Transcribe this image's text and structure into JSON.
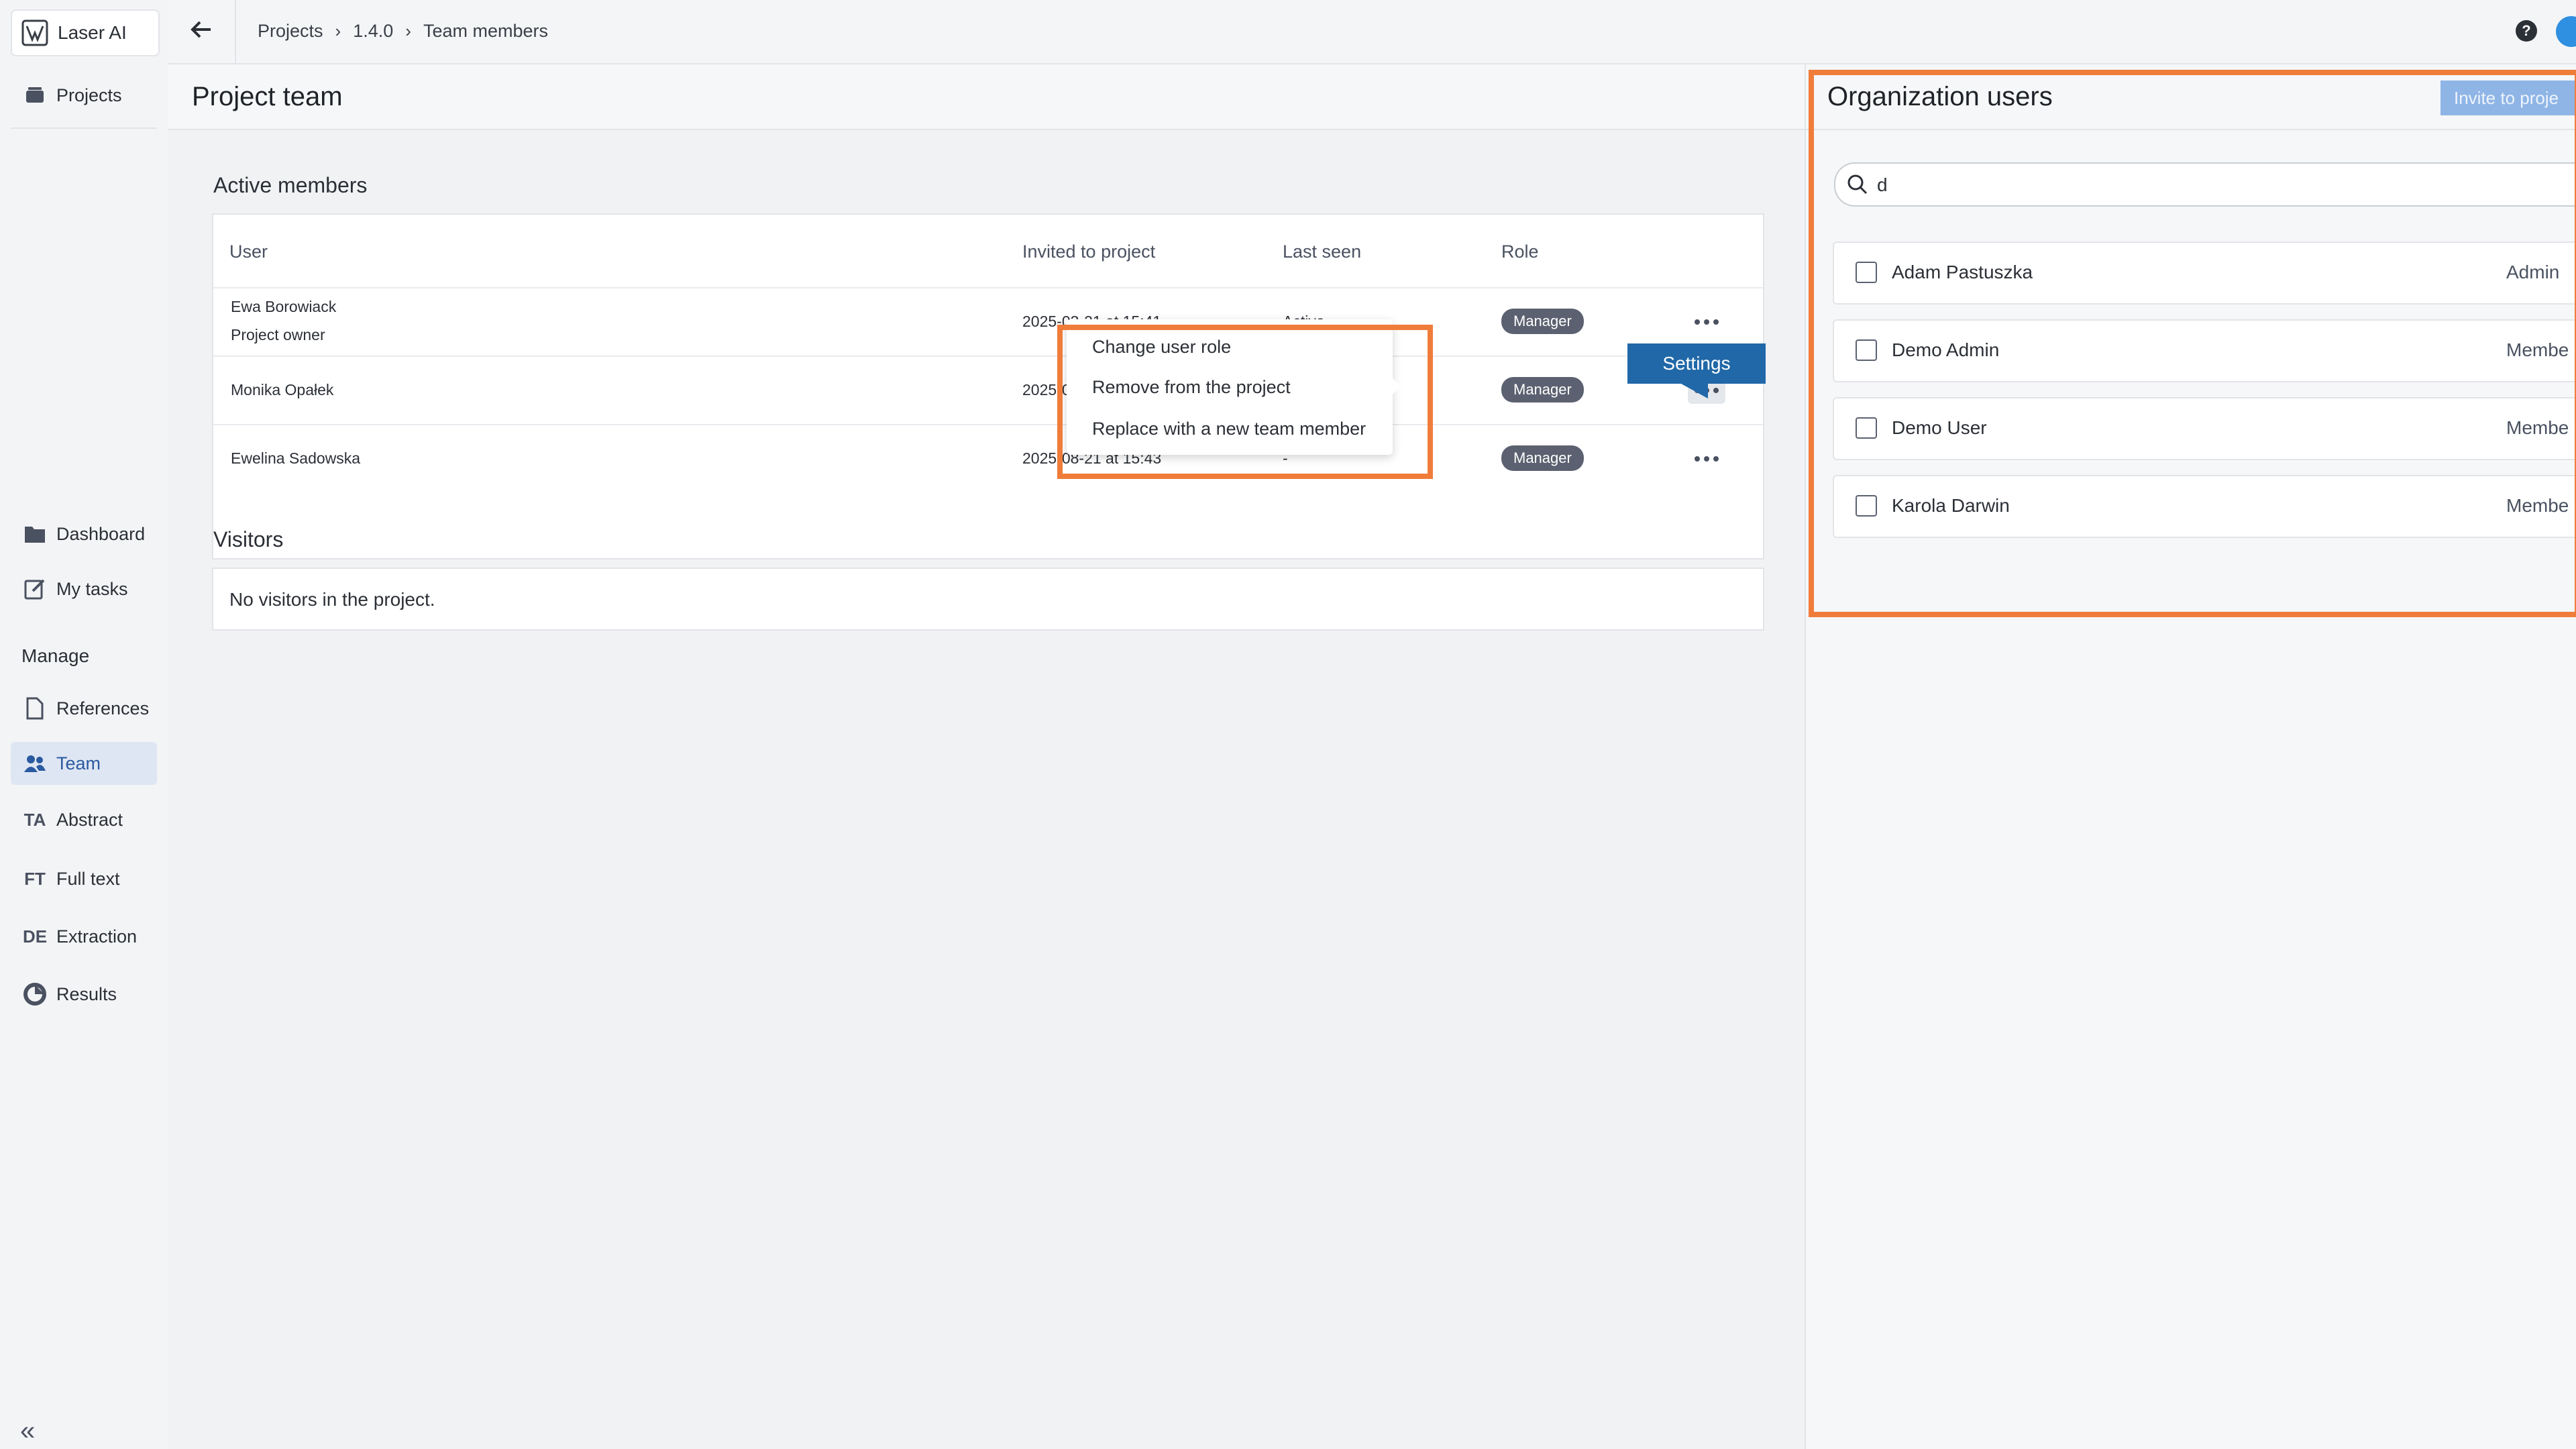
{
  "app": {
    "name": "Laser AI"
  },
  "sidebar": {
    "top_items": [
      {
        "label": "Projects",
        "icon": "folder-stack-icon"
      }
    ],
    "items": [
      {
        "label": "Dashboard",
        "icon": "folder-icon"
      },
      {
        "label": "My tasks",
        "icon": "edit-icon"
      }
    ],
    "section_title": "Manage",
    "manage_items": [
      {
        "label": "References",
        "icon": "document-icon"
      },
      {
        "label": "Team",
        "icon": "users-icon",
        "active": true
      },
      {
        "label": "Abstract",
        "icon": "TA"
      },
      {
        "label": "Full text",
        "icon": "FT"
      },
      {
        "label": "Extraction",
        "icon": "DE"
      },
      {
        "label": "Results",
        "icon": "pie-icon"
      }
    ],
    "collapse_icon": "double-chevron-left-icon"
  },
  "breadcrumb": {
    "items": [
      "Projects",
      "1.4.0",
      "Team members"
    ]
  },
  "page": {
    "title": "Project team"
  },
  "active_members": {
    "title": "Active members",
    "columns": [
      "User",
      "Invited to project",
      "Last seen",
      "Role"
    ],
    "rows": [
      {
        "name": "Ewa Borowiack",
        "sub": "Project owner",
        "invited": "2025-03-21 at 15:41",
        "last_seen": "Active",
        "role": "Manager"
      },
      {
        "name": "Monika Opałek",
        "sub": "",
        "invited": "2025-0",
        "last_seen": "",
        "role": "Manager"
      },
      {
        "name": "Ewelina Sadowska",
        "sub": "",
        "invited": "2025-08-21 at 15:43",
        "last_seen": "-",
        "role": "Manager"
      }
    ]
  },
  "visitors": {
    "title": "Visitors",
    "empty": "No visitors in the project."
  },
  "context_menu": {
    "items": [
      "Change user role",
      "Remove from the project",
      "Replace with a new team member"
    ]
  },
  "tooltip": {
    "label": "Settings"
  },
  "org_users": {
    "title": "Organization users",
    "invite_button": "Invite to proje",
    "search_value": "d",
    "users": [
      {
        "name": "Adam Pastuszka",
        "role": "Admin"
      },
      {
        "name": "Demo Admin",
        "role": "Membe"
      },
      {
        "name": "Demo User",
        "role": "Membe"
      },
      {
        "name": "Karola Darwin",
        "role": "Membe"
      }
    ]
  },
  "colors": {
    "accent": "#2068a8",
    "highlight": "#f07c3a",
    "badge": "#5b6170"
  }
}
